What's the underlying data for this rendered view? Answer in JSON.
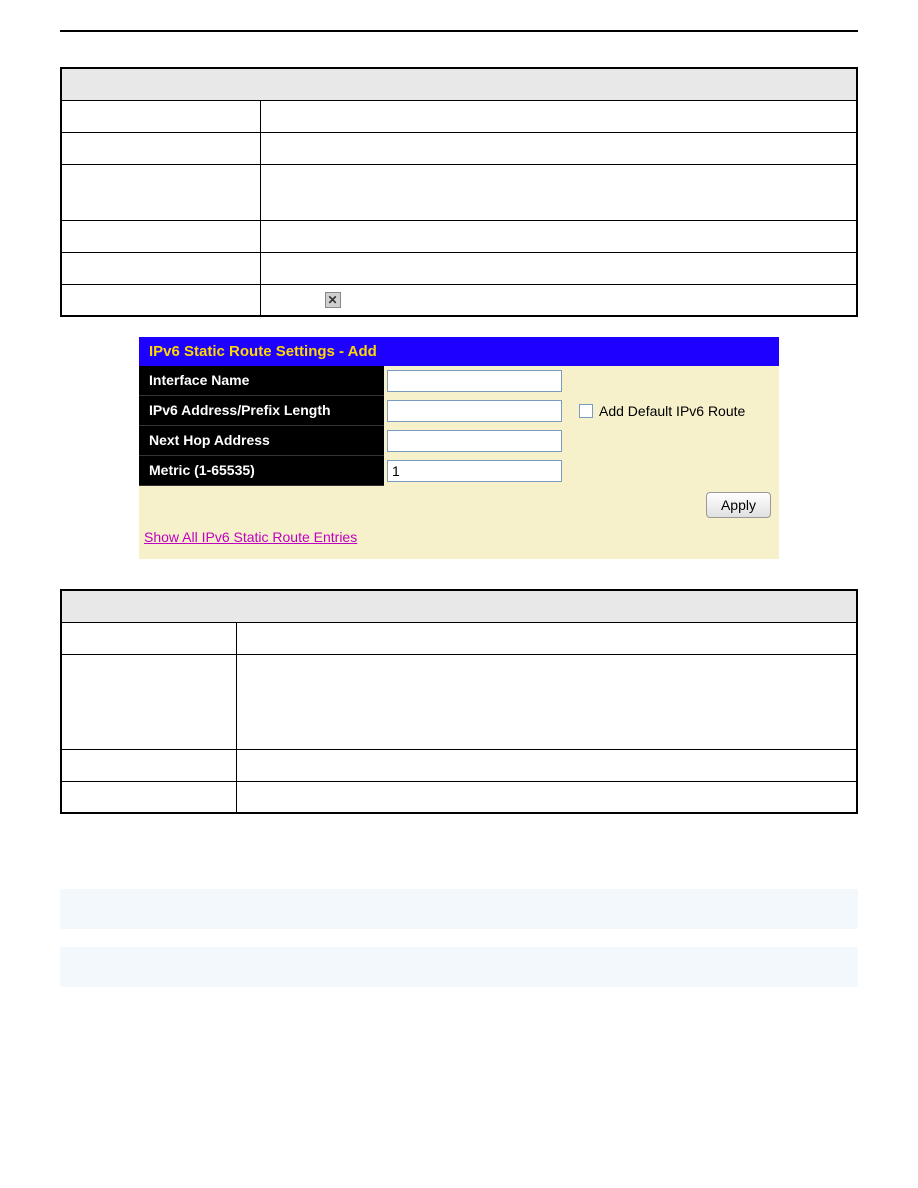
{
  "panel": {
    "title": "IPv6 Static Route Settings - Add",
    "rows": {
      "interface_name": {
        "label": "Interface Name",
        "value": ""
      },
      "ipv6_addr": {
        "label": "IPv6 Address/Prefix Length",
        "value": ""
      },
      "next_hop": {
        "label": "Next Hop Address",
        "value": ""
      },
      "metric": {
        "label": "Metric (1-65535)",
        "value": "1"
      }
    },
    "checkbox_label": "Add Default IPv6 Route",
    "apply_label": "Apply",
    "show_all_label": "Show All IPv6 Static Route Entries"
  },
  "close_icon": "✕"
}
